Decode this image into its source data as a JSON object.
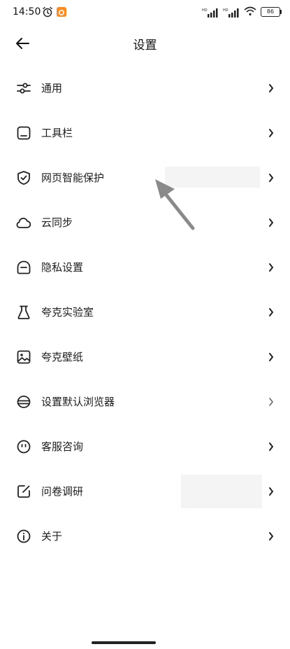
{
  "status_bar": {
    "time": "14:50",
    "battery": "86",
    "icons": [
      "alarm-icon",
      "app-notification-icon",
      "signal-icon",
      "signal-icon",
      "wifi-icon",
      "battery-icon"
    ]
  },
  "header": {
    "title": "设置",
    "back_icon": "arrow-left-icon"
  },
  "menu": {
    "items": [
      {
        "label": "通用",
        "icon": "sliders-icon"
      },
      {
        "label": "工具栏",
        "icon": "toolbar-icon"
      },
      {
        "label": "网页智能保护",
        "icon": "shield-check-icon"
      },
      {
        "label": "云同步",
        "icon": "cloud-icon"
      },
      {
        "label": "隐私设置",
        "icon": "privacy-icon"
      },
      {
        "label": "夸克实验室",
        "icon": "flask-icon"
      },
      {
        "label": "夸克壁纸",
        "icon": "image-icon"
      },
      {
        "label": "设置默认浏览器",
        "icon": "browser-icon"
      },
      {
        "label": "客服咨询",
        "icon": "support-icon"
      },
      {
        "label": "问卷调研",
        "icon": "survey-icon"
      },
      {
        "label": "关于",
        "icon": "info-icon"
      }
    ]
  },
  "colors": {
    "background": "#ffffff",
    "text": "#1a1a1a",
    "icon": "#222222",
    "overlay_arrow": "#8a8a8a",
    "redaction": "#f4f4f4",
    "app_badge": "#ff8a1e"
  }
}
